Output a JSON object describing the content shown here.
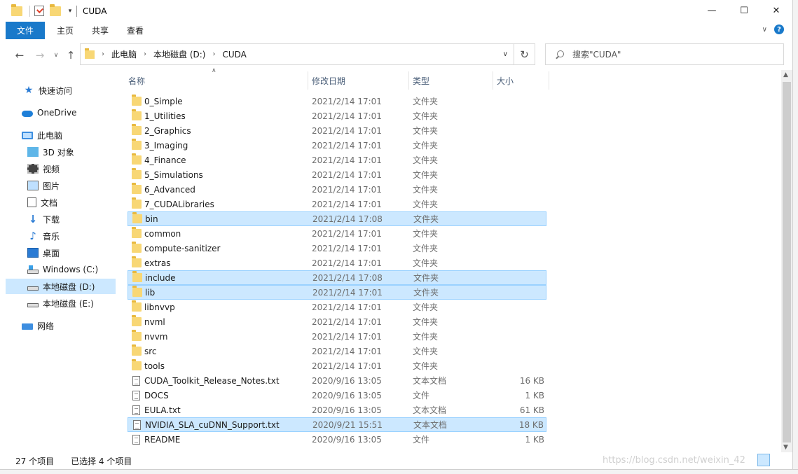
{
  "window": {
    "title": "CUDA",
    "minimize": "—",
    "maximize": "☐",
    "close": "✕"
  },
  "ribbon": {
    "tabs": [
      "文件",
      "主页",
      "共享",
      "查看"
    ],
    "expand_icon": "chevron-down-icon",
    "help_label": "?"
  },
  "address": {
    "crumbs": [
      "此电脑",
      "本地磁盘 (D:)",
      "CUDA"
    ],
    "refresh_icon": "refresh-icon"
  },
  "search": {
    "placeholder": "搜索\"CUDA\""
  },
  "sidebar": {
    "items": [
      {
        "label": "快速访问",
        "icon": "star-icon"
      },
      {
        "label": "OneDrive",
        "icon": "cloud-icon"
      },
      {
        "label": "此电脑",
        "icon": "computer-icon"
      },
      {
        "label": "3D 对象",
        "icon": "3d-objects-icon"
      },
      {
        "label": "视频",
        "icon": "video-icon"
      },
      {
        "label": "图片",
        "icon": "pictures-icon"
      },
      {
        "label": "文档",
        "icon": "documents-icon"
      },
      {
        "label": "下载",
        "icon": "download-icon"
      },
      {
        "label": "音乐",
        "icon": "music-icon"
      },
      {
        "label": "桌面",
        "icon": "desktop-icon"
      },
      {
        "label": "Windows (C:)",
        "icon": "windows-drive-icon"
      },
      {
        "label": "本地磁盘 (D:)",
        "icon": "drive-icon",
        "selected": true
      },
      {
        "label": "本地磁盘 (E:)",
        "icon": "drive-icon"
      },
      {
        "label": "网络",
        "icon": "network-icon"
      }
    ]
  },
  "columns": [
    "名称",
    "修改日期",
    "类型",
    "大小"
  ],
  "files": [
    {
      "name": "0_Simple",
      "date": "2021/2/14 17:01",
      "type": "文件夹",
      "size": "",
      "kind": "folder"
    },
    {
      "name": "1_Utilities",
      "date": "2021/2/14 17:01",
      "type": "文件夹",
      "size": "",
      "kind": "folder"
    },
    {
      "name": "2_Graphics",
      "date": "2021/2/14 17:01",
      "type": "文件夹",
      "size": "",
      "kind": "folder"
    },
    {
      "name": "3_Imaging",
      "date": "2021/2/14 17:01",
      "type": "文件夹",
      "size": "",
      "kind": "folder"
    },
    {
      "name": "4_Finance",
      "date": "2021/2/14 17:01",
      "type": "文件夹",
      "size": "",
      "kind": "folder"
    },
    {
      "name": "5_Simulations",
      "date": "2021/2/14 17:01",
      "type": "文件夹",
      "size": "",
      "kind": "folder"
    },
    {
      "name": "6_Advanced",
      "date": "2021/2/14 17:01",
      "type": "文件夹",
      "size": "",
      "kind": "folder"
    },
    {
      "name": "7_CUDALibraries",
      "date": "2021/2/14 17:01",
      "type": "文件夹",
      "size": "",
      "kind": "folder"
    },
    {
      "name": "bin",
      "date": "2021/2/14 17:08",
      "type": "文件夹",
      "size": "",
      "kind": "folder",
      "selected": true
    },
    {
      "name": "common",
      "date": "2021/2/14 17:01",
      "type": "文件夹",
      "size": "",
      "kind": "folder"
    },
    {
      "name": "compute-sanitizer",
      "date": "2021/2/14 17:01",
      "type": "文件夹",
      "size": "",
      "kind": "folder"
    },
    {
      "name": "extras",
      "date": "2021/2/14 17:01",
      "type": "文件夹",
      "size": "",
      "kind": "folder"
    },
    {
      "name": "include",
      "date": "2021/2/14 17:08",
      "type": "文件夹",
      "size": "",
      "kind": "folder",
      "selected": true
    },
    {
      "name": "lib",
      "date": "2021/2/14 17:01",
      "type": "文件夹",
      "size": "",
      "kind": "folder",
      "selected": true
    },
    {
      "name": "libnvvp",
      "date": "2021/2/14 17:01",
      "type": "文件夹",
      "size": "",
      "kind": "folder"
    },
    {
      "name": "nvml",
      "date": "2021/2/14 17:01",
      "type": "文件夹",
      "size": "",
      "kind": "folder"
    },
    {
      "name": "nvvm",
      "date": "2021/2/14 17:01",
      "type": "文件夹",
      "size": "",
      "kind": "folder"
    },
    {
      "name": "src",
      "date": "2021/2/14 17:01",
      "type": "文件夹",
      "size": "",
      "kind": "folder"
    },
    {
      "name": "tools",
      "date": "2021/2/14 17:01",
      "type": "文件夹",
      "size": "",
      "kind": "folder"
    },
    {
      "name": "CUDA_Toolkit_Release_Notes.txt",
      "date": "2020/9/16 13:05",
      "type": "文本文档",
      "size": "16 KB",
      "kind": "file"
    },
    {
      "name": "DOCS",
      "date": "2020/9/16 13:05",
      "type": "文件",
      "size": "1 KB",
      "kind": "file"
    },
    {
      "name": "EULA.txt",
      "date": "2020/9/16 13:05",
      "type": "文本文档",
      "size": "61 KB",
      "kind": "file"
    },
    {
      "name": "NVIDIA_SLA_cuDNN_Support.txt",
      "date": "2020/9/21 15:51",
      "type": "文本文档",
      "size": "18 KB",
      "kind": "file",
      "selected": true
    },
    {
      "name": "README",
      "date": "2020/9/16 13:05",
      "type": "文件",
      "size": "1 KB",
      "kind": "file"
    }
  ],
  "status": {
    "item_count": "27 个项目",
    "selected_count": "已选择 4 个项目"
  },
  "watermark": "https://blog.csdn.net/weixin_42"
}
